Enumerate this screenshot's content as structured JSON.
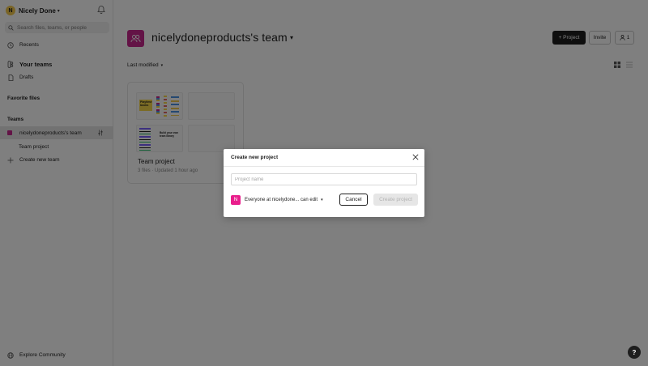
{
  "user": {
    "initial": "N",
    "name": "Nicely Done"
  },
  "search": {
    "placeholder": "Search files, teams, or people"
  },
  "nav": {
    "recents": "Recents",
    "your_teams": "Your teams",
    "drafts": "Drafts"
  },
  "favorites": {
    "label": "Favorite files"
  },
  "teams": {
    "label": "Teams",
    "items": [
      {
        "label": "nicelydoneproducts's team",
        "active": true
      },
      {
        "label": "Team project"
      }
    ],
    "create_label": "Create new team"
  },
  "footer": {
    "explore_label": "Explore Community"
  },
  "header": {
    "title": "nicelydoneproducts's team",
    "project_button": "+ Project",
    "invite_button": "Invite",
    "members_count": "1"
  },
  "toolbar": {
    "sort_label": "Last modified"
  },
  "project_card": {
    "name": "Team project",
    "meta": "3 files · Updated 1 hour ago",
    "thumb1_text": "Playtime books",
    "thumb3_text": "Build your own team library"
  },
  "help": {
    "label": "?"
  },
  "modal": {
    "title": "Create new project",
    "input_placeholder": "Project name",
    "perm_initial": "N",
    "perm_text": "Everyone at nicelydone... can edit",
    "cancel_label": "Cancel",
    "create_label": "Create project"
  },
  "colors": {
    "team_accent": "#c6268c",
    "perm_accent": "#e91e8c",
    "overlay": "rgba(0,0,0,0.5)"
  },
  "icons": [
    "bell-icon",
    "search-icon",
    "clock-icon",
    "team-icon",
    "file-icon",
    "settings-icon",
    "plus-icon",
    "globe-icon",
    "grid-icon",
    "list-icon",
    "person-icon",
    "close-icon",
    "chevron-down-icon"
  ]
}
